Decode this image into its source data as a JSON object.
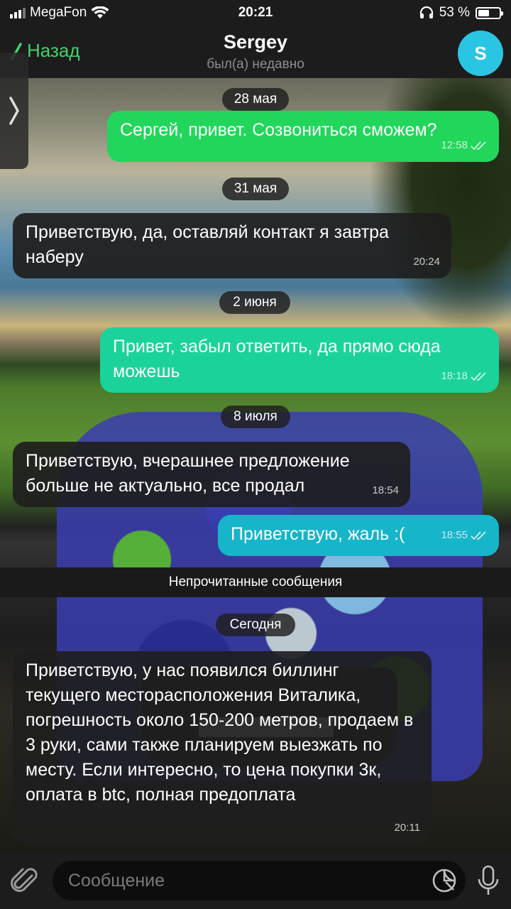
{
  "status_bar": {
    "carrier": "MegaFon",
    "time": "20:21",
    "battery_percent": "53 %",
    "battery_level": 0.53
  },
  "header": {
    "back_label": "Назад",
    "contact_name": "Sergey",
    "contact_status": "был(а) недавно",
    "avatar_letter": "S",
    "avatar_color": "#2bc5e4"
  },
  "messages": [
    {
      "type": "date",
      "text": "28 мая"
    },
    {
      "type": "out",
      "text": "Сергей, привет. Созвониться сможем?",
      "time": "12:58"
    },
    {
      "type": "date",
      "text": "31 мая"
    },
    {
      "type": "in",
      "text": "Приветствую, да, оставляй контакт я завтра наберу",
      "time": "20:24"
    },
    {
      "type": "date",
      "text": "2 июня"
    },
    {
      "type": "out",
      "text": "Привет, забыл ответить, да прямо сюда можешь",
      "time": "18:18"
    },
    {
      "type": "date",
      "text": "8 июля"
    },
    {
      "type": "in",
      "text": "Приветствую, вчерашнее предложение больше не актуально, все продал",
      "time": "18:54"
    },
    {
      "type": "out",
      "text": "Приветствую, жаль :(",
      "time": "18:55"
    },
    {
      "type": "divider",
      "text": "Непрочитанные сообщения"
    },
    {
      "type": "date",
      "text": "Сегодня"
    },
    {
      "type": "in",
      "text": "Приветствую, у нас появился биллинг текущего месторасположения Виталика, погрешность около 150-200 метров, продаем в 3 руки, сами также планируем выезжать по месту. Если интересно, то цена покупки 3к, оплата в btc, полная предоплата",
      "time": "20:11"
    }
  ],
  "input": {
    "placeholder": "Сообщение"
  },
  "colors": {
    "accent_green": "#45d06a",
    "bubble_out_1": "#22d65c",
    "bubble_out_2": "#1bd39a",
    "bubble_out_3": "#16b5c9",
    "bubble_in": "#1e1e1e"
  },
  "icons": [
    "signal-icon",
    "wifi-icon",
    "headphones-icon",
    "battery-icon",
    "back-chevron-icon",
    "side-panel-chevron-icon",
    "read-check-icon",
    "attach-paperclip-icon",
    "sticker-icon",
    "microphone-icon"
  ]
}
